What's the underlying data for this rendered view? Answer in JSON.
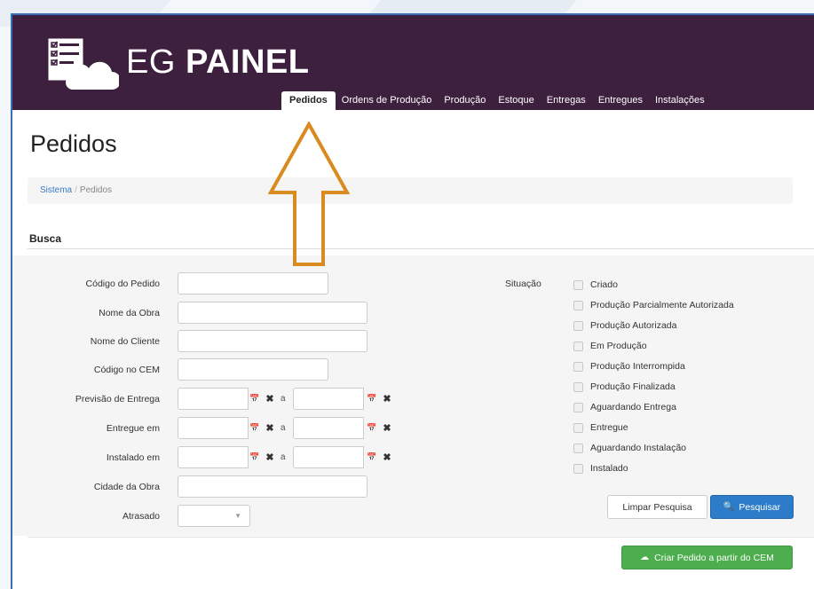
{
  "brand": {
    "prefix": "EG ",
    "bold": "PAINEL"
  },
  "nav": {
    "tabs": [
      {
        "label": "Pedidos",
        "active": true
      },
      {
        "label": "Ordens de Produção",
        "active": false
      },
      {
        "label": "Produção",
        "active": false
      },
      {
        "label": "Estoque",
        "active": false
      },
      {
        "label": "Entregas",
        "active": false
      },
      {
        "label": "Entregues",
        "active": false
      },
      {
        "label": "Instalações",
        "active": false
      }
    ]
  },
  "page": {
    "title": "Pedidos"
  },
  "breadcrumb": {
    "link": "Sistema",
    "separator": "/",
    "current": "Pedidos"
  },
  "search": {
    "title": "Busca",
    "fields": {
      "codigo_pedido": {
        "label": "Código do Pedido",
        "value": ""
      },
      "nome_obra": {
        "label": "Nome da Obra",
        "value": ""
      },
      "nome_cliente": {
        "label": "Nome do Cliente",
        "value": ""
      },
      "codigo_cem": {
        "label": "Código no CEM",
        "value": ""
      },
      "previsao_entrega": {
        "label": "Previsão de Entrega",
        "from": "",
        "to": ""
      },
      "entregue_em": {
        "label": "Entregue em",
        "from": "",
        "to": ""
      },
      "instalado_em": {
        "label": "Instalado em",
        "from": "",
        "to": ""
      },
      "cidade_obra": {
        "label": "Cidade da Obra",
        "value": ""
      },
      "atrasado": {
        "label": "Atrasado",
        "value": ""
      }
    },
    "range_separator": "a",
    "situacao": {
      "label": "Situação",
      "options": [
        {
          "label": "Criado",
          "checked": false
        },
        {
          "label": "Produção Parcialmente Autorizada",
          "checked": false
        },
        {
          "label": "Produção Autorizada",
          "checked": false
        },
        {
          "label": "Em Produção",
          "checked": false
        },
        {
          "label": "Produção Interrompida",
          "checked": false
        },
        {
          "label": "Produção Finalizada",
          "checked": false
        },
        {
          "label": "Aguardando Entrega",
          "checked": false
        },
        {
          "label": "Entregue",
          "checked": false
        },
        {
          "label": "Aguardando Instalação",
          "checked": false
        },
        {
          "label": "Instalado",
          "checked": false
        }
      ]
    },
    "buttons": {
      "clear": "Limpar Pesquisa",
      "search": "Pesquisar"
    }
  },
  "actions": {
    "create_from_cem": "Criar Pedido a partir do CEM"
  },
  "colors": {
    "header": "#3d1f3e",
    "primary": "#2c7cc9",
    "success": "#4cae4c",
    "arrow": "#d98b1f"
  },
  "icons": {
    "logo": "checklist-cloud-icon",
    "calendar": "calendar-icon",
    "clear": "close-icon",
    "search": "search-icon",
    "cloud_upload": "cloud-upload-icon",
    "arrow": "arrow-up-icon"
  }
}
